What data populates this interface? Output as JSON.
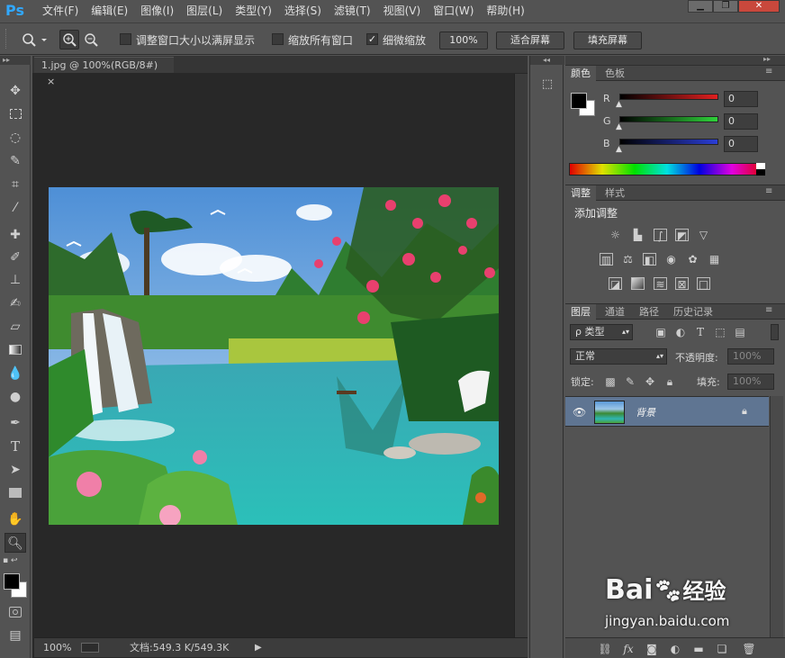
{
  "app": {
    "logo": "Ps"
  },
  "menu": [
    "文件(F)",
    "编辑(E)",
    "图像(I)",
    "图层(L)",
    "类型(Y)",
    "选择(S)",
    "滤镜(T)",
    "视图(V)",
    "窗口(W)",
    "帮助(H)"
  ],
  "window_controls": {
    "minimize": "▁",
    "restore": "❐",
    "close": "✕"
  },
  "options": {
    "resize_windows_label": "调整窗口大小以满屏显示",
    "zoom_all_label": "缩放所有窗口",
    "scrubby_zoom_label": "细微缩放",
    "scrubby_zoom_checked": true,
    "zoom_100_label": "100%",
    "fit_screen_label": "适合屏幕",
    "fill_screen_label": "填充屏幕"
  },
  "document": {
    "tab_title": "1.jpg @ 100%(RGB/8#)",
    "tab_close": "×",
    "zoom": "100%",
    "doc_size": "文档:549.3 K/549.3K"
  },
  "color_panel": {
    "tabs": [
      "颜色",
      "色板"
    ],
    "channels": [
      {
        "name": "R",
        "value": "0",
        "color": "#d22a2a"
      },
      {
        "name": "G",
        "value": "0",
        "color": "#2fbf3a"
      },
      {
        "name": "B",
        "value": "0",
        "color": "#2b3ed6"
      }
    ]
  },
  "adjustments_panel": {
    "tabs": [
      "调整",
      "样式"
    ],
    "title": "添加调整"
  },
  "layers_panel": {
    "tabs": [
      "图层",
      "通道",
      "路径",
      "历史记录"
    ],
    "kind_label": "ρ 类型",
    "blend_mode": "正常",
    "opacity_label": "不透明度:",
    "opacity_value": "100%",
    "lock_label": "锁定:",
    "fill_label": "填充:",
    "fill_value": "100%",
    "layers": [
      {
        "name": "背景",
        "visible": true,
        "locked": true
      }
    ]
  },
  "watermark": {
    "brand": "Bai",
    "brand2": "经验",
    "url": "jingyan.baidu.com"
  }
}
